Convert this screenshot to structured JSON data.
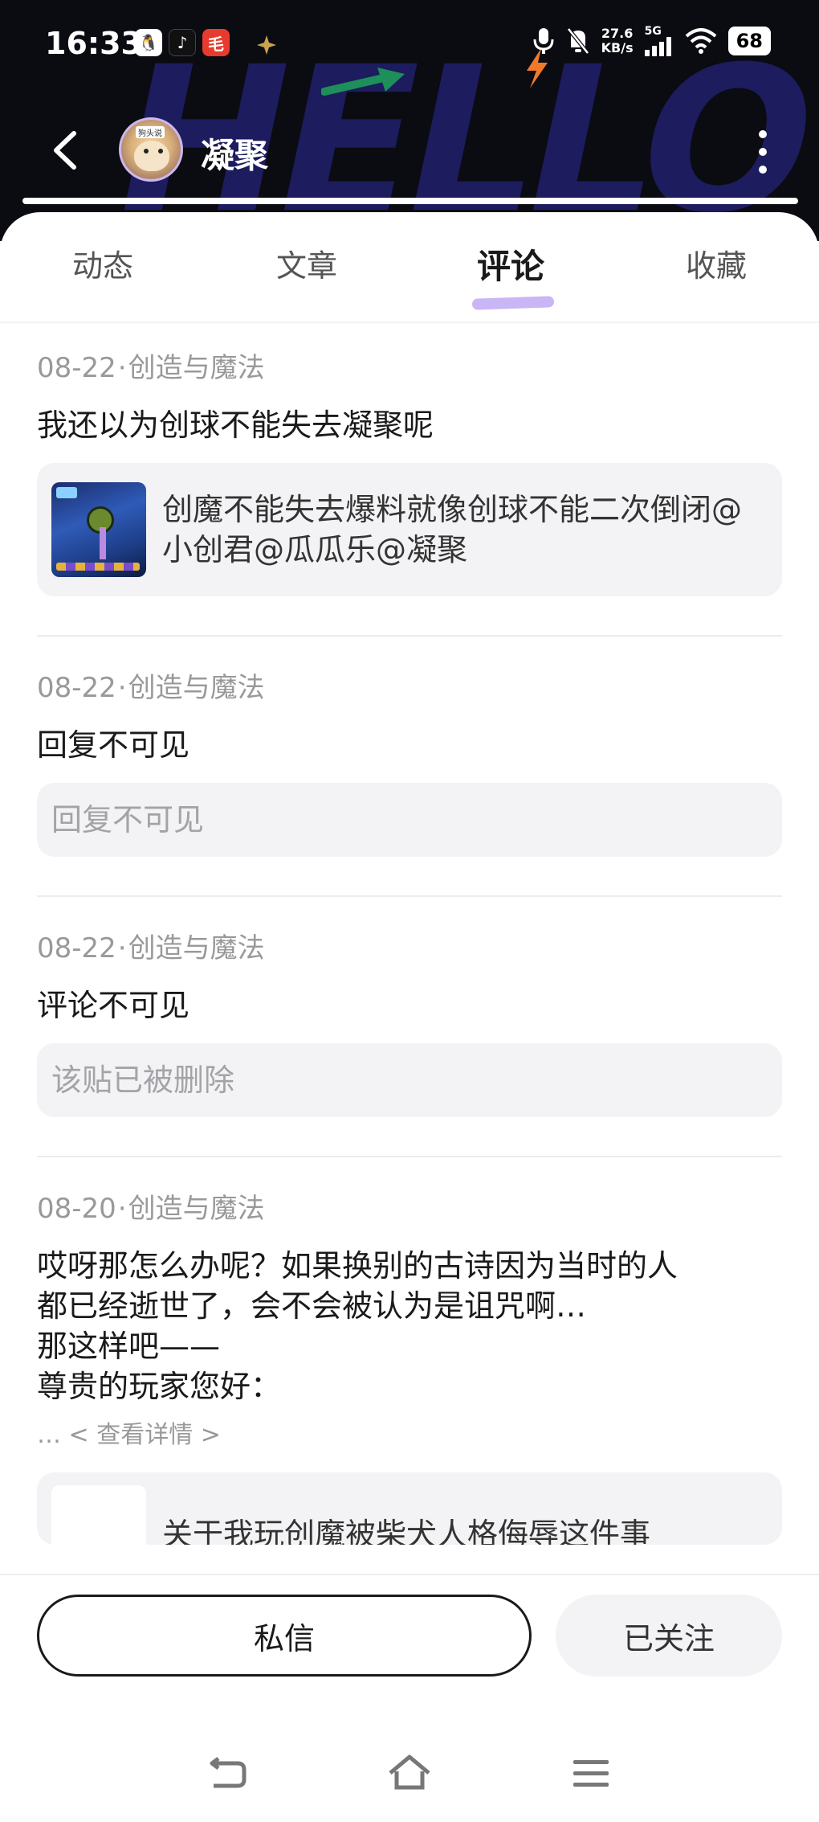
{
  "status_bar": {
    "time": "16:33",
    "app_icons": [
      "qq-icon",
      "tiktok-icon",
      "app-icon"
    ],
    "net_speed_value": "27.6",
    "net_speed_unit": "KB/s",
    "network": "5G",
    "battery": "68"
  },
  "profile": {
    "avatar_tag": "狗头说",
    "username": "凝聚"
  },
  "tabs": [
    {
      "label": "动态",
      "active": false
    },
    {
      "label": "文章",
      "active": false
    },
    {
      "label": "评论",
      "active": true
    },
    {
      "label": "收藏",
      "active": false
    }
  ],
  "feed": [
    {
      "date": "08-22",
      "source": "创造与魔法",
      "content": "我还以为创球不能失去凝聚呢",
      "quote": "创魔不能失去爆料就像创球不能二次倒闭@小创君@瓜瓜乐@凝聚"
    },
    {
      "date": "08-22",
      "source": "创造与魔法",
      "content": "回复不可见",
      "quote": "回复不可见"
    },
    {
      "date": "08-22",
      "source": "创造与魔法",
      "content": "评论不可见",
      "quote": "该贴已被删除"
    },
    {
      "date": "08-20",
      "source": "创造与魔法",
      "content_lines": [
        "哎呀那怎么办呢？如果换别的古诗因为当时的人",
        "都已经逝世了，会不会被认为是诅咒啊…",
        "那这样吧——",
        "尊贵的玩家您好："
      ],
      "detail_link": "… < 查看详情 >",
      "quote_partial": "关于我玩创魔被柴犬人格侮辱这件事"
    }
  ],
  "meta_separator": "·",
  "bottom": {
    "message_button": "私信",
    "follow_button": "已关注"
  },
  "colors": {
    "header_bg": "#0b0b12",
    "tab_underline": "#c9b6f5",
    "card_bg": "#f3f3f5",
    "meta_text": "#999999"
  }
}
